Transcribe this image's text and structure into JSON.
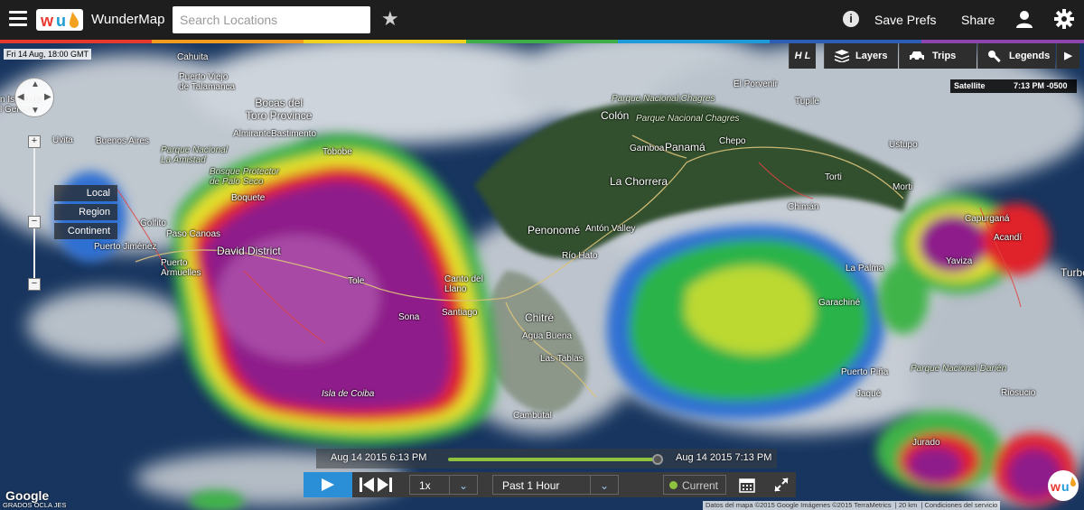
{
  "header": {
    "app_title": "WunderMap",
    "search_placeholder": "Search Locations",
    "save_prefs": "Save Prefs",
    "share": "Share"
  },
  "icons": [
    "menu-icon",
    "wu-logo",
    "star-icon",
    "info-icon",
    "user-icon",
    "gear-icon",
    "layers-icon",
    "trips-icon",
    "legends-icon",
    "hl-icon",
    "play-icon",
    "skip-icon",
    "calendar-icon",
    "expand-icon"
  ],
  "map": {
    "timestamp": "Fri 14 Aug, 18:00 GMT",
    "satellite_label": "Satellite",
    "satellite_time": "7:13 PM -0500",
    "zoom_levels": [
      "Local",
      "Region",
      "Continent"
    ],
    "toolbar": {
      "hl": "H L",
      "layers": "Layers",
      "trips": "Trips",
      "legends": "Legends"
    },
    "labels": {
      "cahuita": "Cahuita",
      "puerto_viejo": "Puerto Viejo\nde Talamanca",
      "bocas": "Bocas del\nToro Province",
      "san_isidro": "n Isidro de\nl General",
      "uvita": "Uvita",
      "buenos_aires": "Buenos Aires",
      "parque_amistad": "Parque Nacional\nLa Amistad",
      "almirante": "Almirante",
      "bastimento": "Bastimento",
      "bosque": "Bosque Protector\nde Palo Seco",
      "tobobe": "Tobobe",
      "boquete": "Boquete",
      "golfito": "Golfito",
      "paso_canoas": "Paso Canoas",
      "puerto_jimenez": "Puerto Jiménez",
      "david": "David District",
      "puerto_armuelles": "Puerto\nArmuelles",
      "tole": "Tole",
      "sona": "Sona",
      "santiago": "Santiago",
      "canto": "Canto del\nLlano",
      "isla_coiba": "Isla de Coiba",
      "parque_chagres_top": "Parque Nacional Chagres",
      "colon": "Colón",
      "parque_chagres": "Parque Nacional Chagres",
      "gamboa": "Gamboa",
      "panama": "Panamá",
      "chepo": "Chepo",
      "la_chorrera": "La Chorrera",
      "penonome": "Penonomé",
      "anton": "Antón Valley",
      "rio_hato": "Río Hato",
      "chitre": "Chitré",
      "agua_buena": "Agua Buena",
      "las_tablas": "Las Tablas",
      "cambutal": "Cambutal",
      "el_porvenir": "El Porvenir",
      "tupile": "Tupile",
      "ustupo": "Ustupo",
      "torti": "Torti",
      "morti": "Morti",
      "chiman": "Chimán",
      "capurgana": "Capurganá",
      "acandi": "Acandí",
      "la_palma": "La Palma",
      "yaviza": "Yaviza",
      "garachine": "Garachiné",
      "turbo": "Turbo",
      "puerto_pina": "Puerto Piña",
      "parque_darien": "Parque Nacional Darién",
      "jaque": "Jaqué",
      "riosucio": "Riosucio",
      "jurado": "Jurado"
    },
    "road_numbers": [
      "2",
      "5",
      "1",
      "2",
      "1"
    ]
  },
  "timeline": {
    "start": "Aug 14 2015 6:13 PM",
    "end": "Aug 14 2015 7:13 PM",
    "speed": "1x",
    "range": "Past 1 Hour",
    "current": "Current",
    "progress": 1.0
  },
  "attribution": {
    "google": "Google",
    "grados": "GRADOS OCLA JES",
    "text": "Datos del mapa ©2015 Google Imágenes ©2015 TerraMetrics",
    "scale": "20 km",
    "terms": "Condiciones del servicio"
  }
}
